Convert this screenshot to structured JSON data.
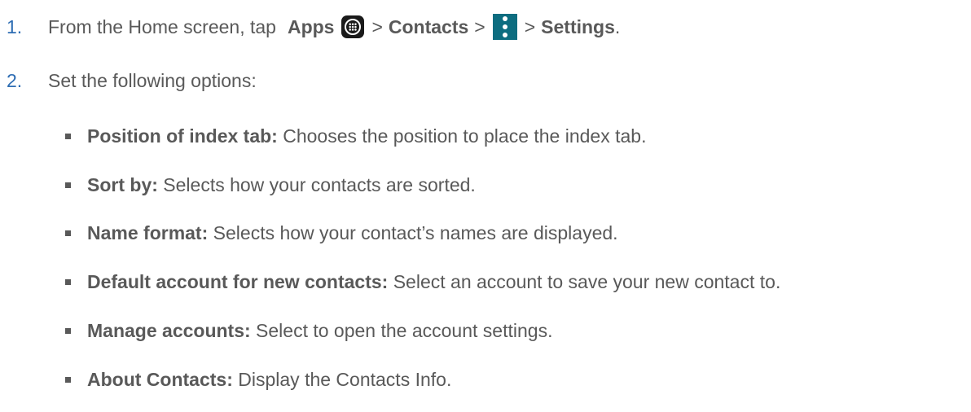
{
  "steps": [
    {
      "number": "1.",
      "text_before": "From the Home screen, tap",
      "apps_label": "Apps",
      "sep1": ">",
      "contacts_label": "Contacts",
      "sep2": ">",
      "sep3": ">",
      "settings_label": "Settings",
      "end": "."
    },
    {
      "number": "2.",
      "text": "Set the following options:"
    }
  ],
  "options": [
    {
      "term": "Position of index tab:",
      "desc": " Chooses the position to place the index tab."
    },
    {
      "term": "Sort by:",
      "desc": " Selects how your contacts are sorted."
    },
    {
      "term": "Name format:",
      "desc": " Selects how your contact’s names are displayed."
    },
    {
      "term": "Default account for new contacts:",
      "desc": " Select an account to save your new contact to."
    },
    {
      "term": "Manage accounts:",
      "desc": " Select to open the account settings."
    },
    {
      "term": "About Contacts:",
      "desc": " Display the Contacts Info."
    }
  ],
  "icons": {
    "apps": "apps-grid-icon",
    "menu": "overflow-menu-icon"
  },
  "colors": {
    "number": "#2e6db3",
    "text": "#595959",
    "menu_icon_bg": "#0d6d80",
    "apps_icon_bg": "#1a1a1a"
  }
}
